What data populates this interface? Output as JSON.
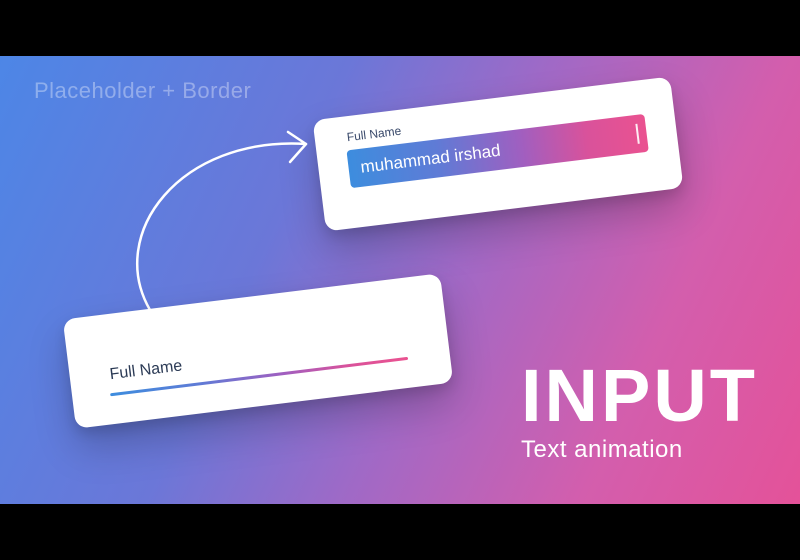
{
  "subtitle": "Placeholder + Border",
  "top_card": {
    "float_label": "Full Name",
    "value": "muhammad irshad"
  },
  "bottom_card": {
    "placeholder": "Full Name"
  },
  "headline": {
    "big": "INPUT",
    "small": "Text animation"
  },
  "colors": {
    "gradient_start": "#4d86e6",
    "gradient_end": "#e45299"
  }
}
